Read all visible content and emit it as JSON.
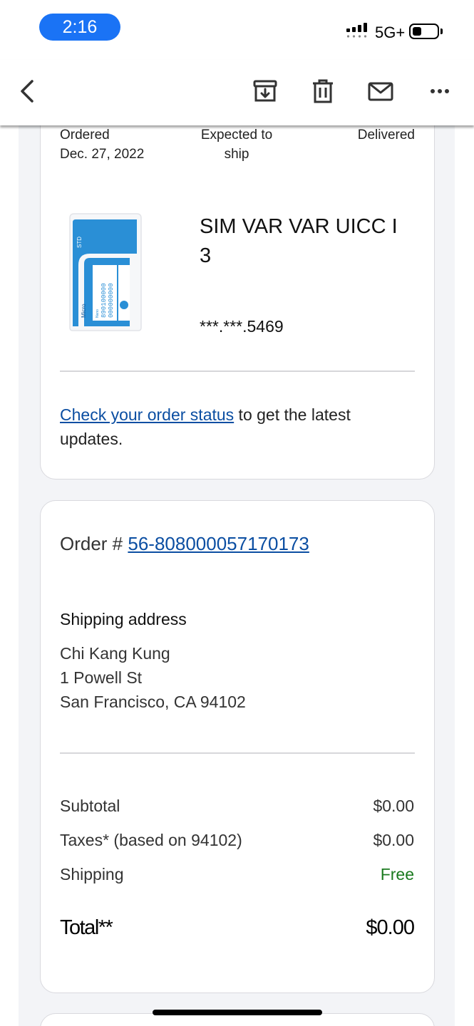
{
  "status_bar": {
    "time": "2:16",
    "network": "5G+"
  },
  "toolbar": {
    "back": "back-icon",
    "archive": "archive-icon",
    "delete": "trash-icon",
    "mark_unread": "mail-icon",
    "more": "more-icon"
  },
  "tracker": {
    "steps": [
      {
        "label": "Ordered",
        "date": "Dec. 27, 2022"
      },
      {
        "label": "Expected to ship"
      },
      {
        "label": "Delivered"
      }
    ]
  },
  "product": {
    "name": "SIM VAR VAR UICC I 3",
    "number": "***.***.5469",
    "sim_card_text": {
      "std": "STD",
      "micro": "Micro",
      "nano": "Nano",
      "iccid_1": "890100000",
      "iccid_2": "000000000"
    }
  },
  "order_status": {
    "link_text": "Check your order status",
    "rest_text": " to get the latest updates."
  },
  "order": {
    "label": "Order # ",
    "number": "56-808000057170173"
  },
  "shipping": {
    "heading": "Shipping address",
    "name": "Chi Kang Kung",
    "street": "1 Powell St",
    "city": "San Francisco, CA 94102"
  },
  "summary": {
    "subtotal_label": "Subtotal",
    "subtotal_value": "$0.00",
    "taxes_label": "Taxes* (based on 94102)",
    "taxes_value": "$0.00",
    "shipping_label": "Shipping",
    "shipping_value": "Free",
    "total_label": "Total**",
    "total_value": "$0.00"
  },
  "colors": {
    "time_pill": "#1a73f5",
    "link": "#0b4ea2",
    "free": "#1b7a1f",
    "sim_blue": "#2a8fd6"
  }
}
